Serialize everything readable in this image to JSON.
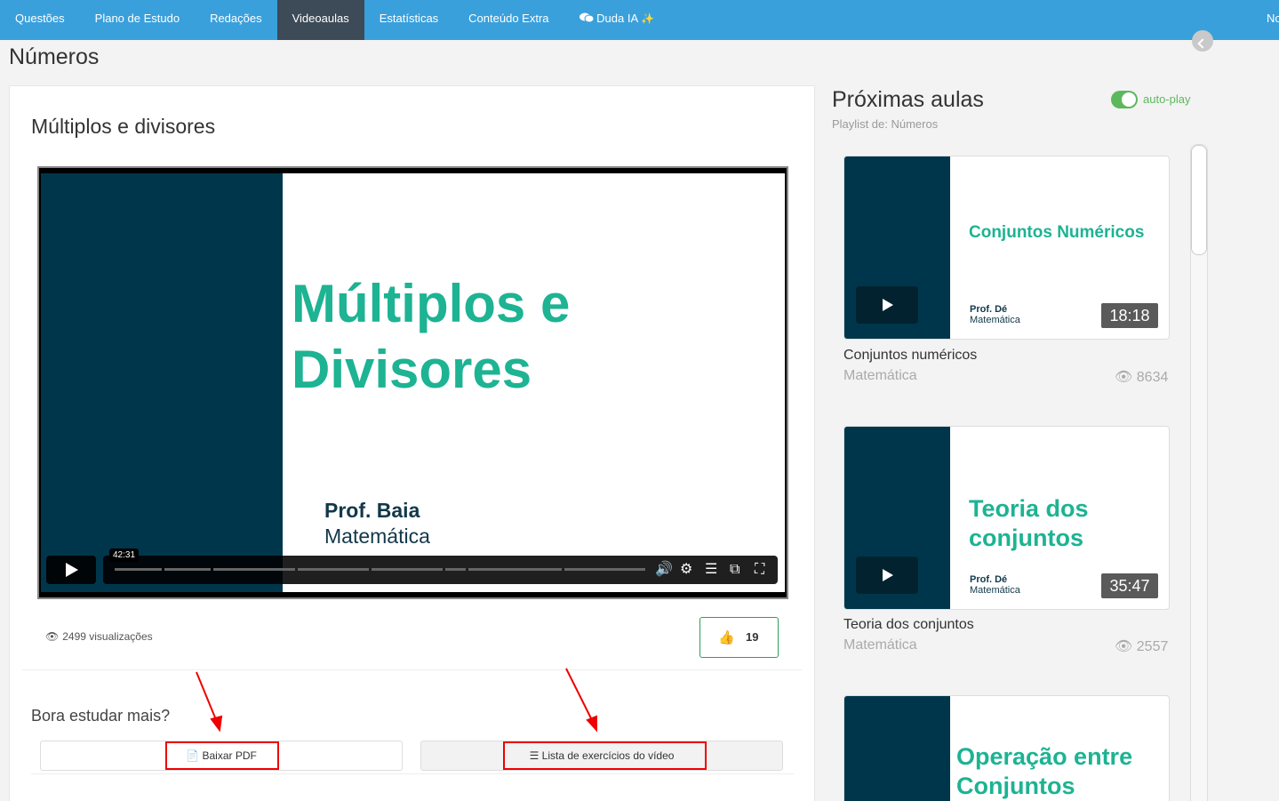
{
  "nav": {
    "items": [
      {
        "label": "Questões",
        "active": false
      },
      {
        "label": "Plano de Estudo",
        "active": false
      },
      {
        "label": "Redações",
        "active": false
      },
      {
        "label": "Videoaulas",
        "active": true
      },
      {
        "label": "Estatísticas",
        "active": false
      },
      {
        "label": "Conteúdo Extra",
        "active": false
      },
      {
        "label": "Duda IA",
        "active": false,
        "icon": "chat-icon",
        "badge_icon": "sparkle-icon"
      }
    ],
    "cut_label": "No"
  },
  "page_title": "Números",
  "lesson": {
    "title": "Múltiplos e divisores",
    "video": {
      "slide_title_line1": "Múltiplos e",
      "slide_title_line2": "Divisores",
      "professor": "Prof. Baia",
      "subject": "Matemática",
      "tooltip_time": "42:31",
      "accent_color": "#1db393",
      "panel_color": "#00364b"
    },
    "views": "2499 visualizações",
    "likes": "19",
    "study_more": "Bora estudar mais?",
    "pdf_button": "Baixar PDF",
    "list_button": "Lista de exercícios do vídeo"
  },
  "sidebar": {
    "title": "Próximas aulas",
    "subtitle": "Playlist de: Números",
    "autoplay_label": "auto-play",
    "autoplay_on": true,
    "items": [
      {
        "thumb_title": "Conjuntos Numéricos",
        "thumb_prof": "Prof. Dé",
        "thumb_subject": "Matemática",
        "duration": "18:18",
        "name": "Conjuntos numéricos",
        "subject": "Matemática",
        "views": "8634"
      },
      {
        "thumb_title_line1": "Teoria dos",
        "thumb_title_line2": "conjuntos",
        "thumb_prof": "Prof. Dé",
        "thumb_subject": "Matemática",
        "duration": "35:47",
        "name": "Teoria dos conjuntos",
        "subject": "Matemática",
        "views": "2557"
      },
      {
        "thumb_title_line1": "Operação entre",
        "thumb_title_line2": "Conjuntos"
      }
    ]
  }
}
